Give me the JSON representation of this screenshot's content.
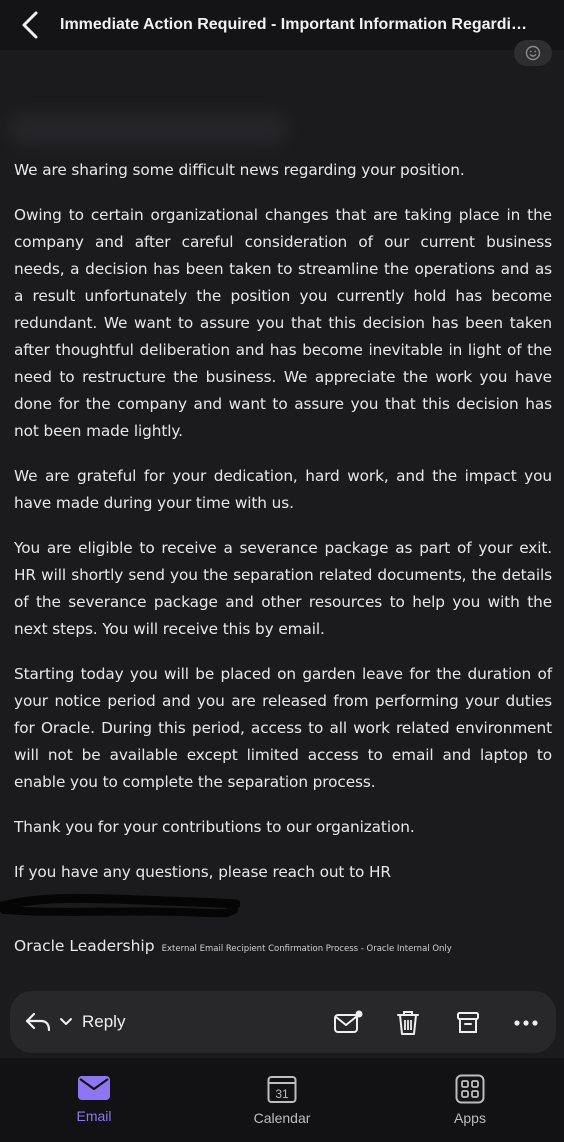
{
  "header": {
    "title": "Immediate Action Required - Important Information Regarding your position"
  },
  "email": {
    "paragraphs": [
      "We are sharing some difficult news regarding your position.",
      "Owing to certain organizational changes that are taking place in the company and after careful consideration of our current business needs, a decision has been taken to streamline the operations and as a result unfortunately the position you currently hold has become redundant. We want to assure you that this decision has been taken after thoughtful deliberation and has become inevitable in light of the need to restructure the business. We appreciate the work you have done for the company and want to assure you that this decision has not been made lightly.",
      "We are grateful for your dedication, hard work, and the impact you have made during your time with us.",
      "You are eligible to receive a severance package as part of your exit. HR will shortly send you the separation related documents, the details of the severance package and other resources to help you with the next steps. You will receive this by email.",
      "Starting today you will be placed on garden leave for the duration of your notice period and you are released from performing your duties for Oracle. During this period, access to all work related environment will not be available except limited access to email and laptop to enable you to complete the separation process.",
      "Thank you for your contributions to our organization.",
      "If you have any questions, please reach out to HR"
    ],
    "signature": "Oracle Leadership",
    "footer_note": "External Email Recipient Confirmation Process - Oracle Internal Only"
  },
  "actions": {
    "reply_label": "Reply"
  },
  "tabs": [
    {
      "label": "Email",
      "active": true
    },
    {
      "label": "Calendar",
      "active": false,
      "day": "31"
    },
    {
      "label": "Apps",
      "active": false
    }
  ],
  "colors": {
    "accent": "#8e76f2",
    "background": "#1b1b1d",
    "bar": "#28282b"
  },
  "icons": [
    "back-arrow-icon",
    "emoji-reaction-icon",
    "reply-icon",
    "chevron-down-icon",
    "mark-unread-icon",
    "trash-icon",
    "archive-icon",
    "more-icon",
    "email-icon",
    "calendar-icon",
    "apps-icon"
  ]
}
